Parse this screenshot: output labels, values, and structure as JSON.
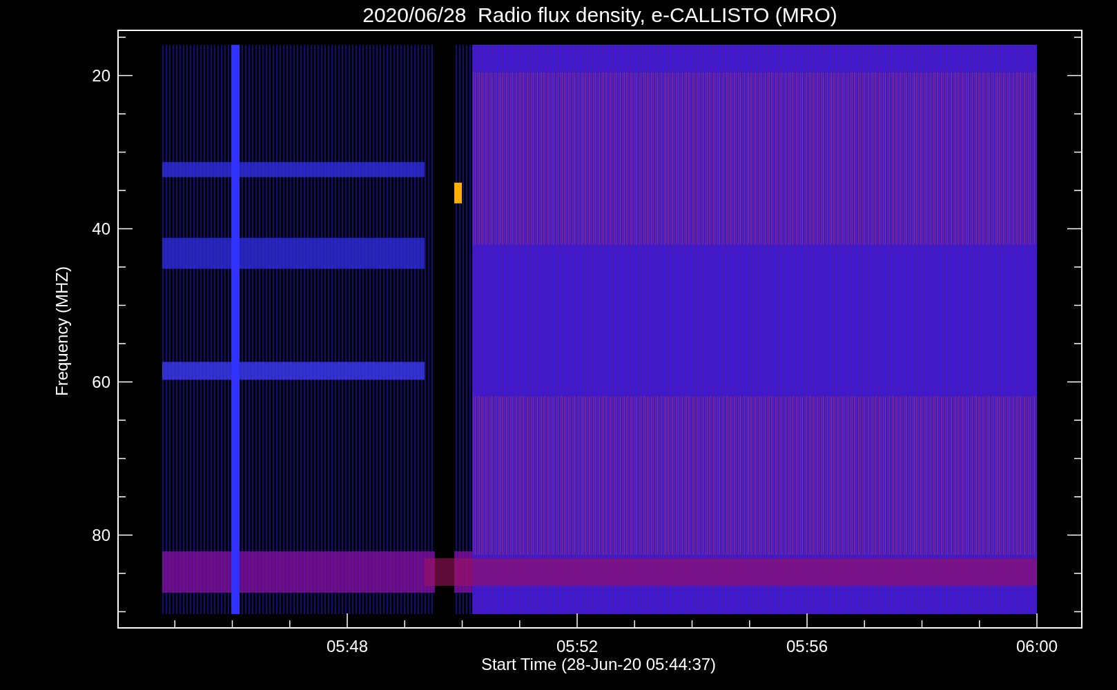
{
  "plot": {
    "title": "2020/06/28  Radio flux density, e-CALLISTO (MRO)",
    "ylabel": "Frequency (MHZ)",
    "yticks": [
      "20",
      "40",
      "60",
      "80"
    ],
    "xticks": [
      "05:48",
      "05:52",
      "05:56",
      "06:00"
    ],
    "xlabel": "Start Time (28-Jun-20 05:44:37)"
  }
}
